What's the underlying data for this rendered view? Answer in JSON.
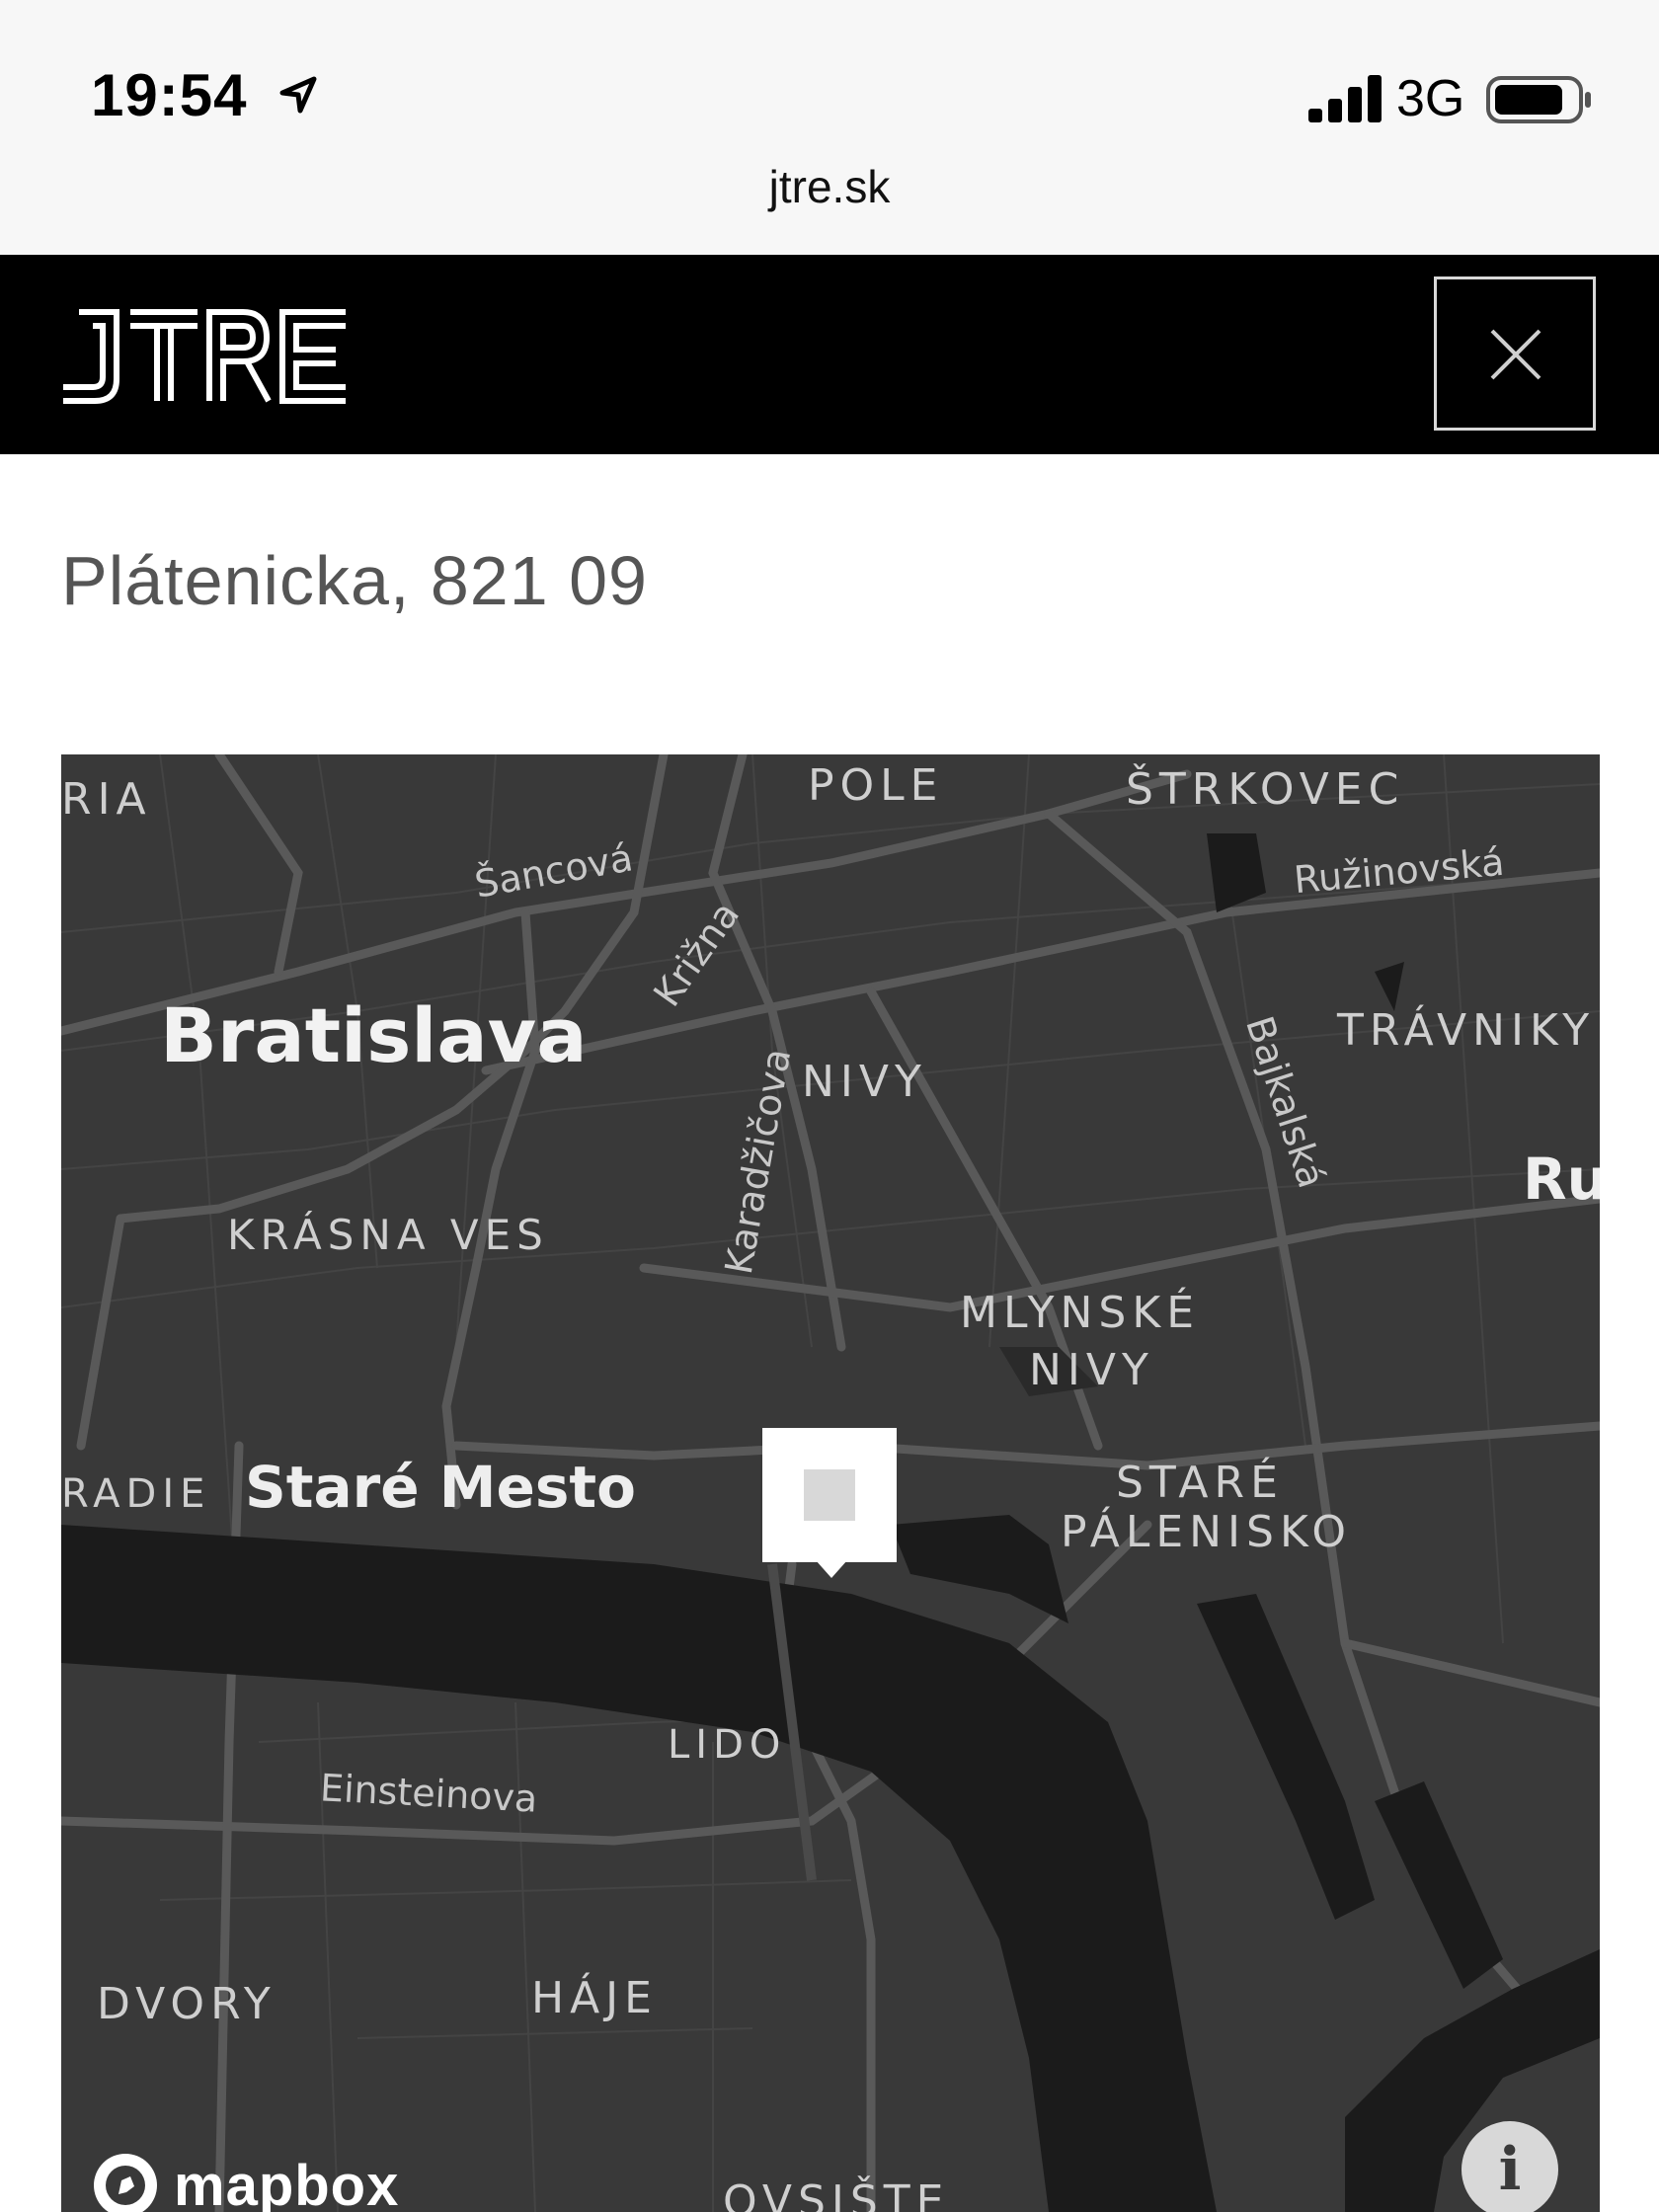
{
  "status_bar": {
    "time": "19:54",
    "network": "3G",
    "icons": [
      "location-arrow-icon",
      "signal-icon",
      "battery-icon"
    ]
  },
  "browser": {
    "url": "jtre.sk"
  },
  "header": {
    "logo_text": "JTRE",
    "close_icon": "close-icon",
    "background": "#000000"
  },
  "address": "Plátenicka, 821 09",
  "map": {
    "labels": {
      "ria": "RIA",
      "pole": "POLE",
      "strkovec": "ŠTRKOVEC",
      "sancova": "Šancová",
      "ruzinovska": "Ružinovská",
      "krizna": "Križna",
      "bratislava": "Bratislava",
      "travniky": "TRÁVNIKY",
      "bajkalska": "Bajkalská",
      "karadzicova": "Karadžičova",
      "nivy": "NIVY",
      "ru": "Ru",
      "krasna_ves": "KRÁSNA VES",
      "mlynske": "MLYNSKÉ",
      "nivy2": "NIVY",
      "radie": "RADIE",
      "stare_mesto": "Staré Mesto",
      "stare": "STARÉ",
      "palenisko": "PÁLENISKO",
      "lido": "LIDO",
      "einsteinova": "Einsteinova",
      "dvory": "DVORY",
      "haje": "HÁJE",
      "ovsiste": "OVSIŠTE"
    },
    "attribution": "mapbox",
    "info_label": "i",
    "colors": {
      "land": "#393939",
      "water": "#1b1b1b",
      "roads": "#555555"
    }
  }
}
